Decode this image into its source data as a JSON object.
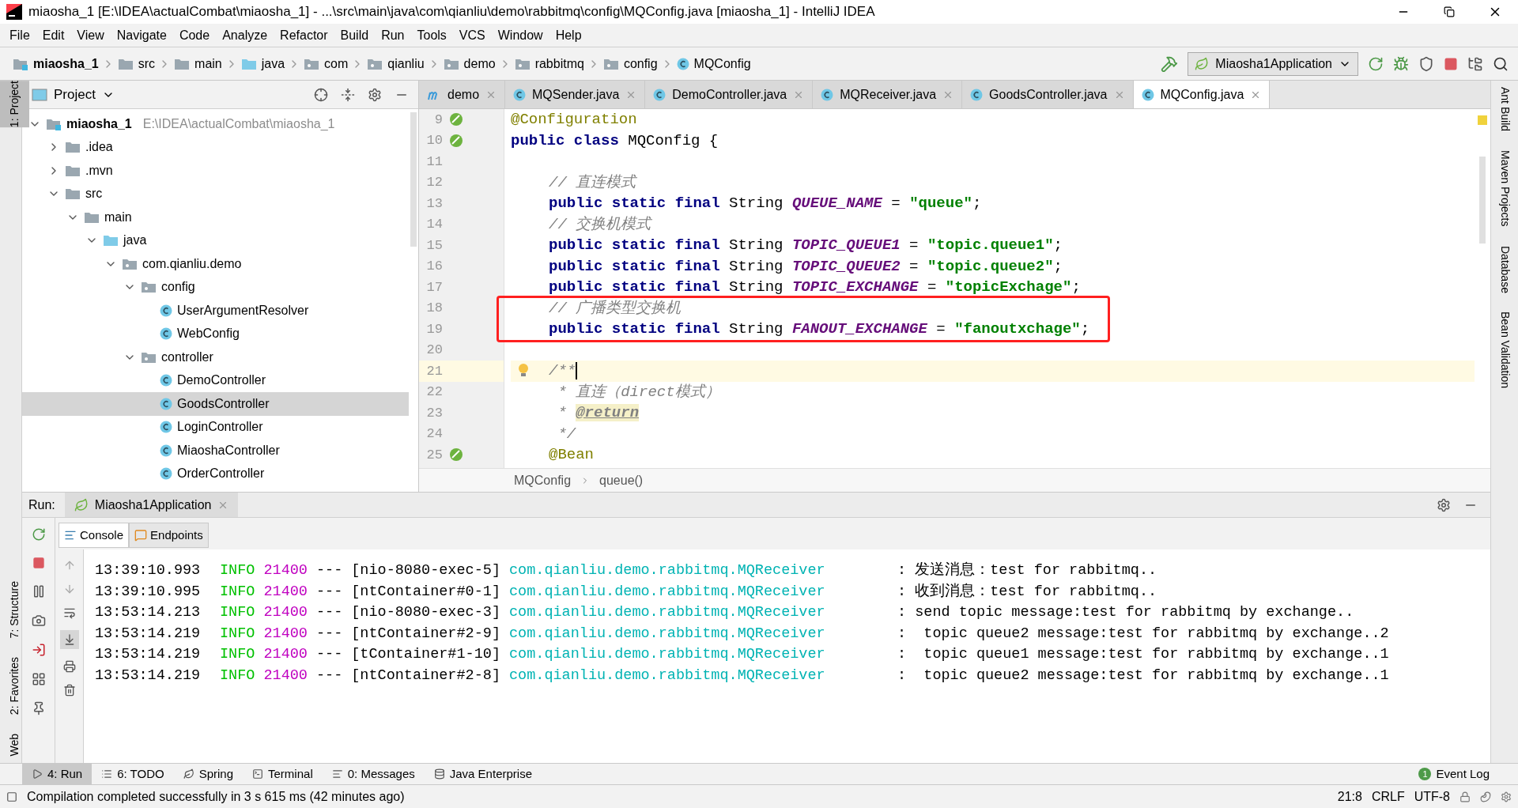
{
  "window": {
    "title": "miaosha_1 [E:\\IDEA\\actualCombat\\miaosha_1] - ...\\src\\main\\java\\com\\qianliu\\demo\\rabbitmq\\config\\MQConfig.java [miaosha_1] - IntelliJ IDEA"
  },
  "menu": [
    "File",
    "Edit",
    "View",
    "Navigate",
    "Code",
    "Analyze",
    "Refactor",
    "Build",
    "Run",
    "Tools",
    "VCS",
    "Window",
    "Help"
  ],
  "nav": [
    {
      "kind": "module",
      "label": "miaosha_1"
    },
    {
      "kind": "folder",
      "label": "src"
    },
    {
      "kind": "folder",
      "label": "main"
    },
    {
      "kind": "source",
      "label": "java"
    },
    {
      "kind": "package",
      "label": "com"
    },
    {
      "kind": "package",
      "label": "qianliu"
    },
    {
      "kind": "package",
      "label": "demo"
    },
    {
      "kind": "package",
      "label": "rabbitmq"
    },
    {
      "kind": "package",
      "label": "config"
    },
    {
      "kind": "class",
      "label": "MQConfig"
    }
  ],
  "run_config": "Miaosha1Application",
  "left_strip": [
    {
      "label": "1: Project",
      "selected": true
    },
    {
      "label": "7: Structure",
      "selected": false
    },
    {
      "label": "2: Favorites",
      "selected": false
    },
    {
      "label": "Web",
      "selected": false
    }
  ],
  "right_strip": [
    "Ant Build",
    "Maven Projects",
    "Database",
    "Bean Validation"
  ],
  "project": {
    "title": "Project",
    "tree": [
      {
        "kind": "module",
        "label": "miaosha_1",
        "path": "E:\\IDEA\\actualCombat\\miaosha_1",
        "expanded": true,
        "selected": false,
        "children": [
          {
            "kind": "folder",
            "label": ".idea",
            "expanded": false,
            "selected": false
          },
          {
            "kind": "folder",
            "label": ".mvn",
            "expanded": false,
            "selected": false
          },
          {
            "kind": "folder",
            "label": "src",
            "expanded": true,
            "selected": false,
            "children": [
              {
                "kind": "folder",
                "label": "main",
                "expanded": true,
                "selected": false,
                "children": [
                  {
                    "kind": "source",
                    "label": "java",
                    "expanded": true,
                    "selected": false,
                    "children": [
                      {
                        "kind": "package",
                        "label": "com.qianliu.demo",
                        "expanded": true,
                        "selected": false,
                        "children": [
                          {
                            "kind": "package",
                            "label": "config",
                            "expanded": true,
                            "selected": false,
                            "children": [
                              {
                                "kind": "class",
                                "label": "UserArgumentResolver",
                                "selected": false
                              },
                              {
                                "kind": "class",
                                "label": "WebConfig",
                                "selected": false
                              }
                            ]
                          },
                          {
                            "kind": "package",
                            "label": "controller",
                            "expanded": true,
                            "selected": false,
                            "children": [
                              {
                                "kind": "class",
                                "label": "DemoController",
                                "selected": false
                              },
                              {
                                "kind": "class",
                                "label": "GoodsController",
                                "selected": true
                              },
                              {
                                "kind": "class",
                                "label": "LoginController",
                                "selected": false
                              },
                              {
                                "kind": "class",
                                "label": "MiaoshaController",
                                "selected": false
                              },
                              {
                                "kind": "class",
                                "label": "OrderController",
                                "selected": false
                              }
                            ]
                          }
                        ]
                      }
                    ]
                  }
                ]
              }
            ]
          }
        ]
      }
    ]
  },
  "editor_tabs": [
    {
      "kind": "module",
      "label": "demo",
      "selected": false
    },
    {
      "kind": "class",
      "label": "MQSender.java",
      "selected": false
    },
    {
      "kind": "class",
      "label": "DemoController.java",
      "selected": false
    },
    {
      "kind": "class",
      "label": "MQReceiver.java",
      "selected": false
    },
    {
      "kind": "class",
      "label": "GoodsController.java",
      "selected": false
    },
    {
      "kind": "class",
      "label": "MQConfig.java",
      "selected": true
    }
  ],
  "code": [
    {
      "number": "9",
      "indented": false,
      "boxed": false,
      "current": false,
      "tokens": [
        {
          "kind": "annotation",
          "text": "@Configuration"
        }
      ]
    },
    {
      "number": "10",
      "indented": false,
      "boxed": false,
      "current": false,
      "tokens": [
        {
          "kind": "keyword",
          "text": "public class "
        },
        {
          "kind": "plain",
          "text": "MQConfig {"
        }
      ]
    },
    {
      "number": "11",
      "boxed": false,
      "current": false
    },
    {
      "number": "12",
      "indented": true,
      "boxed": false,
      "current": false,
      "tokens": [
        {
          "kind": "comment",
          "text": "// 直连模式"
        }
      ]
    },
    {
      "number": "13",
      "indented": true,
      "boxed": false,
      "current": false,
      "tokens": [
        {
          "kind": "keyword",
          "text": "public static final "
        },
        {
          "kind": "plain",
          "text": "String "
        },
        {
          "kind": "constant",
          "text": "QUEUE_NAME"
        },
        {
          "kind": "plain",
          "text": " = "
        },
        {
          "kind": "string",
          "text": "\"queue\""
        },
        {
          "kind": "plain",
          "text": ";"
        }
      ]
    },
    {
      "number": "14",
      "indented": true,
      "boxed": false,
      "current": false,
      "tokens": [
        {
          "kind": "comment",
          "text": "// 交换机模式"
        }
      ]
    },
    {
      "number": "15",
      "indented": true,
      "boxed": false,
      "current": false,
      "tokens": [
        {
          "kind": "keyword",
          "text": "public static final "
        },
        {
          "kind": "plain",
          "text": "String "
        },
        {
          "kind": "constant",
          "text": "TOPIC_QUEUE1"
        },
        {
          "kind": "plain",
          "text": " = "
        },
        {
          "kind": "string",
          "text": "\"topic.queue1\""
        },
        {
          "kind": "plain",
          "text": ";"
        }
      ]
    },
    {
      "number": "16",
      "indented": true,
      "boxed": false,
      "current": false,
      "tokens": [
        {
          "kind": "keyword",
          "text": "public static final "
        },
        {
          "kind": "plain",
          "text": "String "
        },
        {
          "kind": "constant",
          "text": "TOPIC_QUEUE2"
        },
        {
          "kind": "plain",
          "text": " = "
        },
        {
          "kind": "string",
          "text": "\"topic.queue2\""
        },
        {
          "kind": "plain",
          "text": ";"
        }
      ]
    },
    {
      "number": "17",
      "indented": true,
      "boxed": false,
      "current": false,
      "tokens": [
        {
          "kind": "keyword",
          "text": "public static final "
        },
        {
          "kind": "plain",
          "text": "String "
        },
        {
          "kind": "constant",
          "text": "TOPIC_EXCHANGE"
        },
        {
          "kind": "plain",
          "text": " = "
        },
        {
          "kind": "string",
          "text": "\"topicExchage\""
        },
        {
          "kind": "plain",
          "text": ";"
        }
      ]
    },
    {
      "number": "18",
      "indented": true,
      "boxed": true,
      "current": false,
      "tokens": [
        {
          "kind": "comment",
          "text": "// 广播类型交换机"
        }
      ]
    },
    {
      "number": "19",
      "indented": true,
      "boxed": true,
      "current": false,
      "tokens": [
        {
          "kind": "keyword",
          "text": "public static final "
        },
        {
          "kind": "plain",
          "text": "String "
        },
        {
          "kind": "constant",
          "text": "FANOUT_EXCHANGE"
        },
        {
          "kind": "plain",
          "text": " = "
        },
        {
          "kind": "string",
          "text": "\"fanoutxchage\""
        },
        {
          "kind": "plain",
          "text": ";"
        }
      ]
    },
    {
      "number": "20",
      "boxed": false,
      "current": false
    },
    {
      "number": "21",
      "indented": true,
      "boxed": false,
      "current": true,
      "tokens": [
        {
          "kind": "comment",
          "text": "/**"
        }
      ]
    },
    {
      "number": "22",
      "indented": true,
      "boxed": false,
      "current": false,
      "tokens": [
        {
          "kind": "comment",
          "text": " * 直连（direct模式）"
        }
      ]
    },
    {
      "number": "23",
      "indented": true,
      "boxed": false,
      "current": false,
      "tokens": [
        {
          "kind": "comment",
          "text": " * "
        },
        {
          "kind": "doctag",
          "text": "@return"
        }
      ]
    },
    {
      "number": "24",
      "indented": true,
      "boxed": false,
      "current": false,
      "tokens": [
        {
          "kind": "comment",
          "text": " */"
        }
      ]
    },
    {
      "number": "25",
      "indented": true,
      "boxed": false,
      "current": false,
      "tokens": [
        {
          "kind": "annotation",
          "text": "@Bean"
        }
      ]
    }
  ],
  "editor_breadcrumb": [
    "MQConfig",
    "queue()"
  ],
  "run": {
    "label": "Run:",
    "tab": "Miaosha1Application",
    "subtabs": [
      {
        "label": "Console",
        "selected": true
      },
      {
        "label": "Endpoints",
        "selected": false
      }
    ],
    "lines": [
      {
        "time": "13:39:10.993",
        "level": "INFO",
        "pid": "21400",
        "sep": "---",
        "thread": "[nio-8080-exec-5]",
        "logger": "com.qianliu.demo.rabbitmq.MQReceiver",
        "message": ": 发送消息：test for rabbitmq.."
      },
      {
        "time": "13:39:10.995",
        "level": "INFO",
        "pid": "21400",
        "sep": "---",
        "thread": "[ntContainer#0-1]",
        "logger": "com.qianliu.demo.rabbitmq.MQReceiver",
        "message": ": 收到消息：test for rabbitmq.."
      },
      {
        "time": "13:53:14.213",
        "level": "INFO",
        "pid": "21400",
        "sep": "---",
        "thread": "[nio-8080-exec-3]",
        "logger": "com.qianliu.demo.rabbitmq.MQReceiver",
        "message": ": send topic message:test for rabbitmq by exchange.."
      },
      {
        "time": "13:53:14.219",
        "level": "INFO",
        "pid": "21400",
        "sep": "---",
        "thread": "[ntContainer#2-9]",
        "logger": "com.qianliu.demo.rabbitmq.MQReceiver",
        "message": ":  topic queue2 message:test for rabbitmq by exchange..2"
      },
      {
        "time": "13:53:14.219",
        "level": "INFO",
        "pid": "21400",
        "sep": "---",
        "thread": "[tContainer#1-10]",
        "logger": "com.qianliu.demo.rabbitmq.MQReceiver",
        "message": ":  topic queue1 message:test for rabbitmq by exchange..1"
      },
      {
        "time": "13:53:14.219",
        "level": "INFO",
        "pid": "21400",
        "sep": "---",
        "thread": "[ntContainer#2-8]",
        "logger": "com.qianliu.demo.rabbitmq.MQReceiver",
        "message": ":  topic queue2 message:test for rabbitmq by exchange..1"
      }
    ]
  },
  "tool_tabs": [
    {
      "kind": "run",
      "label": "4: Run",
      "selected": true
    },
    {
      "kind": "todo",
      "label": "6: TODO",
      "selected": false
    },
    {
      "kind": "spring",
      "label": "Spring",
      "selected": false
    },
    {
      "kind": "terminal",
      "label": "Terminal",
      "selected": false
    },
    {
      "kind": "messages",
      "label": "0: Messages",
      "selected": false
    },
    {
      "kind": "javaee",
      "label": "Java Enterprise",
      "selected": false
    }
  ],
  "event_log": {
    "label": "Event Log",
    "count": "1"
  },
  "status_bar": {
    "message": "Compilation completed successfully in 3 s 615 ms (42 minutes ago)",
    "position": "21:8",
    "line_sep": "CRLF",
    "encoding": "UTF-8"
  }
}
